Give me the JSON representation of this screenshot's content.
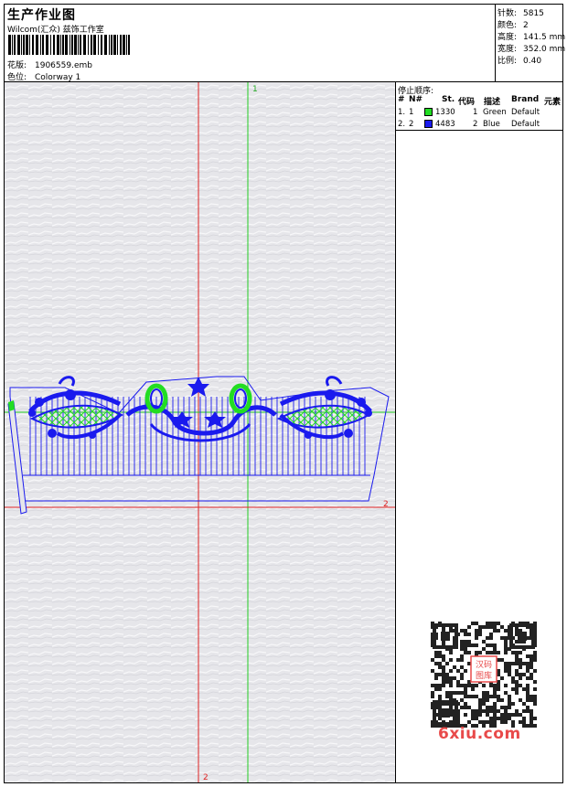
{
  "header": {
    "title": "生产作业图",
    "company": "Wilcom(汇众) 兹饰工作室",
    "design_label": "花版:",
    "design_value": "1906559.emb",
    "colorway_label": "色位:",
    "colorway_value": "Colorway 1"
  },
  "stats": [
    {
      "label": "针数:",
      "value": "5815"
    },
    {
      "label": "颜色:",
      "value": "2"
    },
    {
      "label": "高度:",
      "value": "141.5 mm"
    },
    {
      "label": "宽度:",
      "value": "352.0 mm"
    },
    {
      "label": "比例:",
      "value": "0.40"
    }
  ],
  "stop_sequence": {
    "title": "停止顺序:",
    "columns": [
      "#",
      "N#",
      "St.",
      "代码",
      "描述",
      "Brand",
      "元素"
    ],
    "rows": [
      {
        "idx": "1.",
        "n": "1",
        "st": "1330",
        "code": "1",
        "desc": "Green",
        "brand": "Default",
        "color": "#22dd22"
      },
      {
        "idx": "2.",
        "n": "2",
        "st": "4483",
        "code": "2",
        "desc": "Blue",
        "brand": "Default",
        "color": "#1a1aee"
      }
    ]
  },
  "canvas": {
    "guide_labels": {
      "green_top": "1",
      "red_right": "2",
      "red_bottom": "2"
    },
    "colors": {
      "green_guide": "#22cc22",
      "red_guide": "#dd2222",
      "thread_blue": "#1a1aee",
      "thread_green": "#22dd22"
    }
  },
  "watermark": {
    "qr_text": "汉码图库",
    "site": "6xiu.com"
  }
}
